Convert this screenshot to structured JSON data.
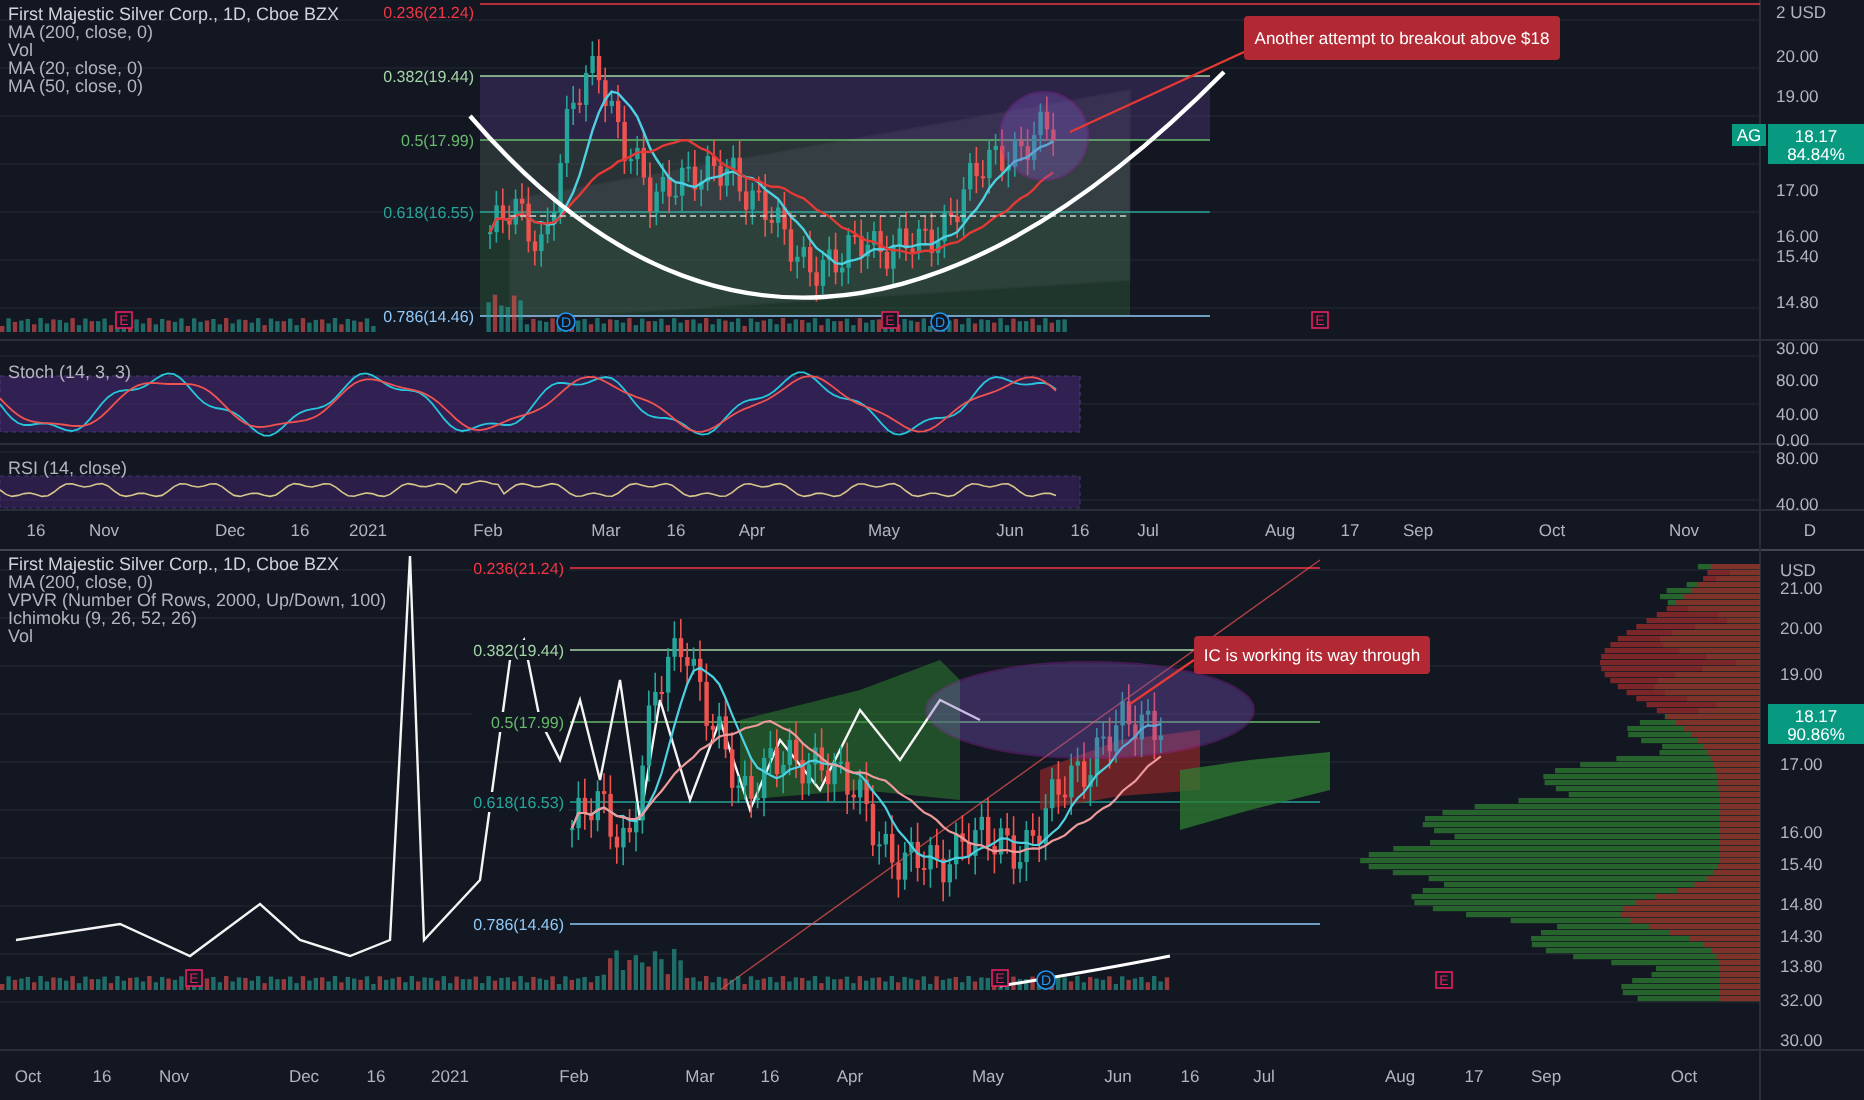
{
  "top_chart": {
    "legend": [
      "First Majestic Silver Corp., 1D, Cboe BZX",
      "MA (200, close, 0)",
      "Vol",
      "MA (20, close, 0)",
      "MA (50, close, 0)"
    ],
    "fib_levels": [
      {
        "label": "0.236(21.24)",
        "color": "#f23645"
      },
      {
        "label": "0.382(19.44)",
        "color": "#a5d6a7"
      },
      {
        "label": "0.5(17.99)",
        "color": "#66bb6a"
      },
      {
        "label": "0.618(16.55)",
        "color": "#26a69a"
      },
      {
        "label": "0.786(14.46)",
        "color": "#90caf9"
      }
    ],
    "callout": "Another attempt to breakout above $18",
    "price_tag": {
      "symbol": "AG",
      "price": "18.17",
      "change": "84.84%"
    },
    "price_axis": [
      "2 USD",
      "20.00",
      "19.00",
      "17.00",
      "16.00",
      "15.40",
      "14.80",
      "30.00",
      "80.00",
      "40.00",
      "0.00",
      "80.00",
      "40.00"
    ],
    "events": [
      {
        "kind": "earnings",
        "label": "E"
      },
      {
        "kind": "dividend",
        "label": "D"
      },
      {
        "kind": "earnings",
        "label": "E"
      },
      {
        "kind": "dividend",
        "label": "D"
      },
      {
        "kind": "earnings",
        "label": "E"
      }
    ],
    "stoch": {
      "label": "Stoch (14, 3, 3)"
    },
    "rsi": {
      "label": "RSI (14, close)"
    },
    "time_axis": [
      "16",
      "Nov",
      "Dec",
      "16",
      "2021",
      "Feb",
      "Mar",
      "16",
      "Apr",
      "May",
      "Jun",
      "16",
      "Jul",
      "Aug",
      "17",
      "Sep",
      "Oct",
      "Nov",
      "D"
    ]
  },
  "bottom_chart": {
    "legend": [
      "First Majestic Silver Corp., 1D, Cboe BZX",
      "MA (200, close, 0)",
      "VPVR (Number Of Rows, 2000, Up/Down, 100)",
      "Ichimoku (9, 26, 52, 26)",
      "Vol"
    ],
    "fib_levels": [
      {
        "label": "0.236(21.24)",
        "color": "#f23645"
      },
      {
        "label": "0.382(19.44)",
        "color": "#a5d6a7"
      },
      {
        "label": "0.5(17.99)",
        "color": "#66bb6a"
      },
      {
        "label": "0.618(16.53)",
        "color": "#26a69a"
      },
      {
        "label": "0.786(14.46)",
        "color": "#90caf9"
      }
    ],
    "callout": "IC is working its way through",
    "price_tag": {
      "price": "18.17",
      "change": "90.86%"
    },
    "price_axis": [
      "USD",
      "21.00",
      "20.00",
      "19.00",
      "17.00",
      "16.00",
      "15.40",
      "14.80",
      "14.30",
      "13.80",
      "32.00",
      "30.00"
    ],
    "events": [
      {
        "kind": "earnings",
        "label": "E"
      },
      {
        "kind": "earnings",
        "label": "E"
      },
      {
        "kind": "dividend",
        "label": "D"
      },
      {
        "kind": "earnings",
        "label": "E"
      }
    ],
    "time_axis": [
      "Oct",
      "16",
      "Nov",
      "Dec",
      "16",
      "2021",
      "Feb",
      "Mar",
      "16",
      "Apr",
      "May",
      "Jun",
      "16",
      "Jul",
      "Aug",
      "17",
      "Sep",
      "Oct"
    ]
  }
}
